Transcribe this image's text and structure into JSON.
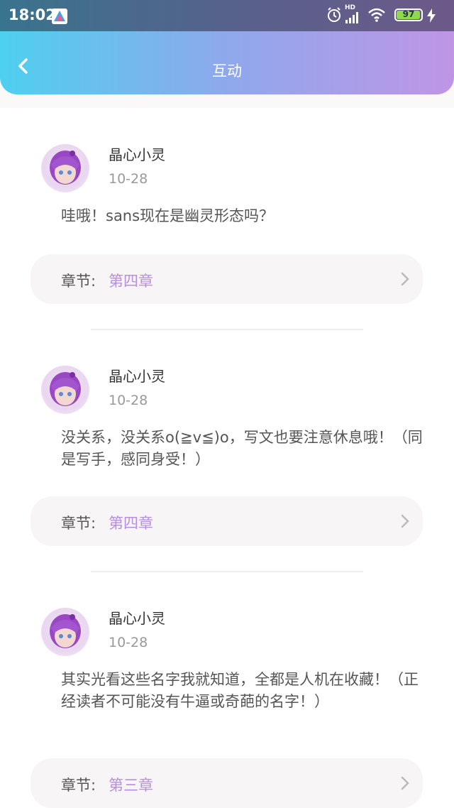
{
  "status_bar": {
    "time": "18:02",
    "network": "HD",
    "battery": "97",
    "battery_level": 0.97,
    "icons": [
      "app-icon",
      "alarm-icon",
      "signal-icon",
      "wifi-icon",
      "battery-icon",
      "charging-icon"
    ]
  },
  "header": {
    "title": "互动",
    "back_icon": "chevron-left-icon"
  },
  "colors": {
    "accent": "#b88ee0",
    "gradient_start": "#4ed0ef",
    "gradient_end": "#bf95e6"
  },
  "chapter_prefix": "章节:",
  "comments": [
    {
      "name": "晶心小灵",
      "date": "10-28",
      "text": "哇哦！sans现在是幽灵形态吗？",
      "chapter": "第四章"
    },
    {
      "name": "晶心小灵",
      "date": "10-28",
      "text": "没关系，没关系o(≧v≦)o，写文也要注意休息哦！（同是写手，感同身受！）",
      "chapter": "第四章"
    },
    {
      "name": "晶心小灵",
      "date": "10-28",
      "text": "其实光看这些名字我就知道，全都是人机在收藏！（正经读者不可能没有牛逼或奇葩的名字！）",
      "chapter": "第三章"
    }
  ]
}
